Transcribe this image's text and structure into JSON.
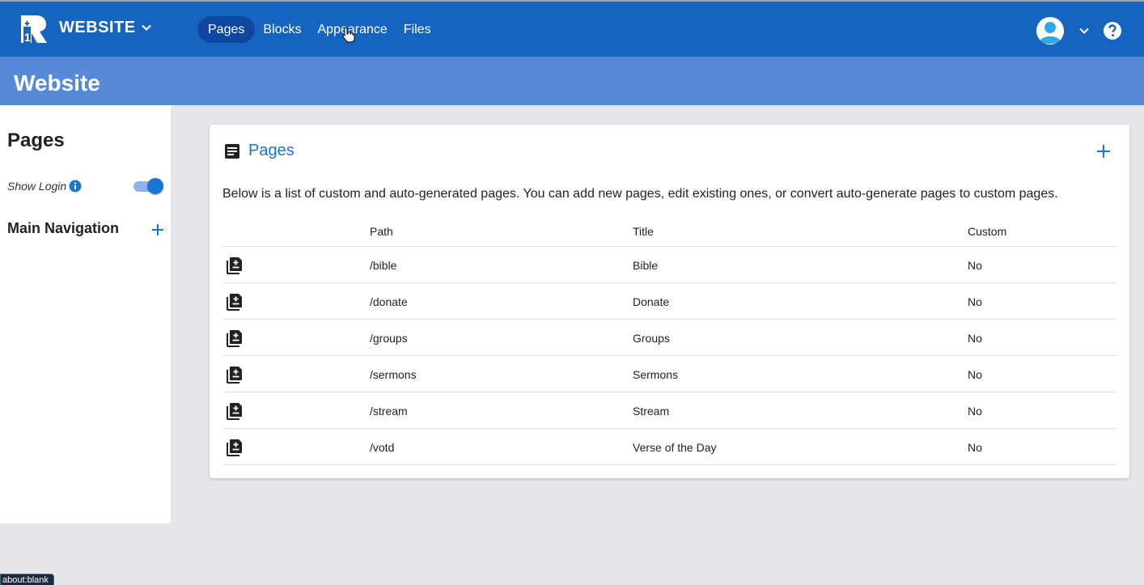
{
  "topbar": {
    "site_name": "WEBSITE",
    "nav": [
      {
        "label": "Pages",
        "active": true
      },
      {
        "label": "Blocks",
        "active": false
      },
      {
        "label": "Appearance",
        "active": false
      },
      {
        "label": "Files",
        "active": false
      }
    ],
    "colors": {
      "bar": "#1565c0",
      "active_pill": "#0d47a1"
    }
  },
  "subheader": {
    "title": "Website"
  },
  "sidebar": {
    "title": "Pages",
    "show_login_label": "Show Login",
    "show_login_enabled": true,
    "main_navigation_label": "Main Navigation"
  },
  "card": {
    "title": "Pages",
    "description": "Below is a list of custom and auto-generated pages. You can add new pages, edit existing ones, or convert auto-generate pages to custom pages.",
    "columns": [
      "",
      "Path",
      "Title",
      "Custom"
    ],
    "rows": [
      {
        "icon": "add-page-icon",
        "path": "/bible",
        "title": "Bible",
        "custom": "No"
      },
      {
        "icon": "add-page-icon",
        "path": "/donate",
        "title": "Donate",
        "custom": "No"
      },
      {
        "icon": "add-page-icon",
        "path": "/groups",
        "title": "Groups",
        "custom": "No"
      },
      {
        "icon": "add-page-icon",
        "path": "/sermons",
        "title": "Sermons",
        "custom": "No"
      },
      {
        "icon": "add-page-icon",
        "path": "/stream",
        "title": "Stream",
        "custom": "No"
      },
      {
        "icon": "add-page-icon",
        "path": "/votd",
        "title": "Verse of the Day",
        "custom": "No"
      }
    ]
  },
  "status_tip": "about:blank"
}
